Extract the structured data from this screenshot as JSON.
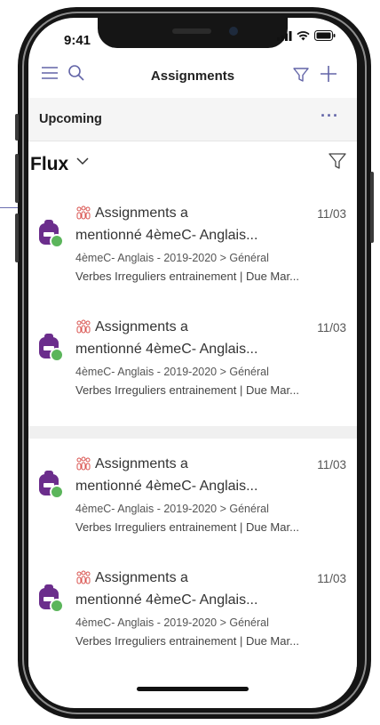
{
  "status": {
    "time": "9:41"
  },
  "header": {
    "title": "Assignments"
  },
  "upcoming": {
    "label": "Upcoming",
    "more": "···"
  },
  "flux": {
    "label": "Flux"
  },
  "items": [
    {
      "title": "Assignments a",
      "date": "11/03",
      "mention": "mentionné 4èmeC- Anglais...",
      "path": "4èmeC- Anglais - 2019-2020 > Général",
      "detail": "Verbes Irreguliers entrainement | Due Mar..."
    },
    {
      "title": "Assignments a",
      "date": "11/03",
      "mention": "mentionné 4èmeC- Anglais...",
      "path": "4èmeC- Anglais - 2019-2020 > Général",
      "detail": "Verbes Irreguliers entrainement | Due Mar..."
    },
    {
      "title": "Assignments a",
      "date": "11/03",
      "mention": "mentionné 4èmeC- Anglais...",
      "path": "4èmeC- Anglais - 2019-2020 > Général",
      "detail": "Verbes Irreguliers entrainement | Due Mar..."
    },
    {
      "title": "Assignments a",
      "date": "11/03",
      "mention": "mentionné 4èmeC- Anglais...",
      "path": "4èmeC- Anglais - 2019-2020 > Général",
      "detail": "Verbes Irreguliers entrainement | Due Mar..."
    }
  ],
  "colors": {
    "accent": "#6264a7",
    "badge": "#5bb55b",
    "avatar": "#6b2d8c",
    "mention_icon": "#d9534f"
  },
  "icons": [
    "hamburger-icon",
    "search-icon",
    "filter-icon",
    "plus-icon",
    "chevron-down-icon",
    "more-icon",
    "assignment-icon",
    "check-badge-icon",
    "mention-icon"
  ]
}
